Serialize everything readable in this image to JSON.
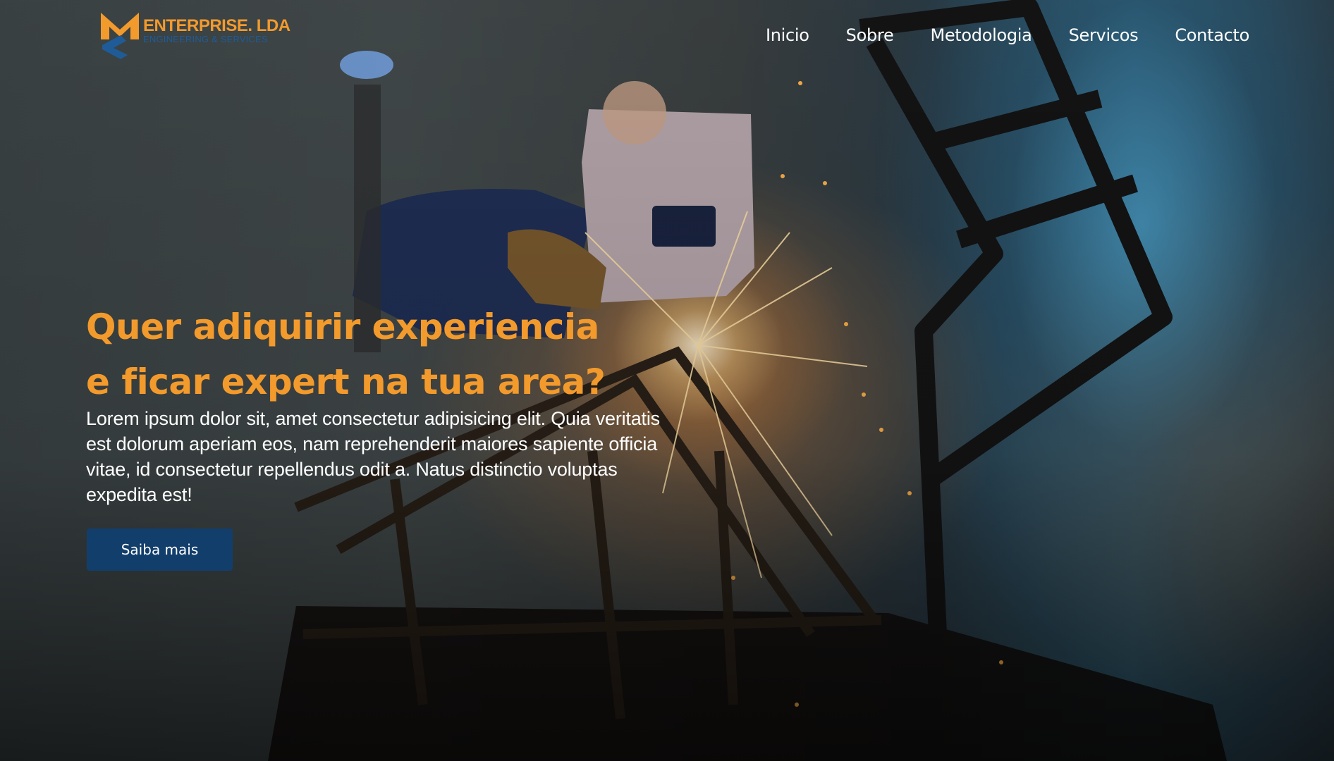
{
  "brand": {
    "name": "ENTERPRISE. LDA",
    "tagline": "ENGINEERING & SERVICES",
    "logo_icon": "ms-monogram-icon"
  },
  "nav": {
    "items": [
      {
        "label": "Inicio"
      },
      {
        "label": "Sobre"
      },
      {
        "label": "Metodologia"
      },
      {
        "label": "Servicos"
      },
      {
        "label": "Contacto"
      }
    ]
  },
  "hero": {
    "headline_line1": "Quer adiquirir experiencia",
    "headline_line2": "e ficar expert na tua area?",
    "lead": "Lorem ipsum dolor sit, amet consectetur adipisicing elit. Quia veritatis est dolorum aperiam eos, nam reprehenderit maiores sapiente officia vitae, id consectetur repellendus odit a. Natus distinctio voluptas expedita est!",
    "cta_label": "Saiba mais",
    "background_image": "welder-with-sparks-image"
  },
  "colors": {
    "accent_orange": "#f39a2c",
    "brand_blue": "#123e6b",
    "nav_text": "#ffffff"
  }
}
